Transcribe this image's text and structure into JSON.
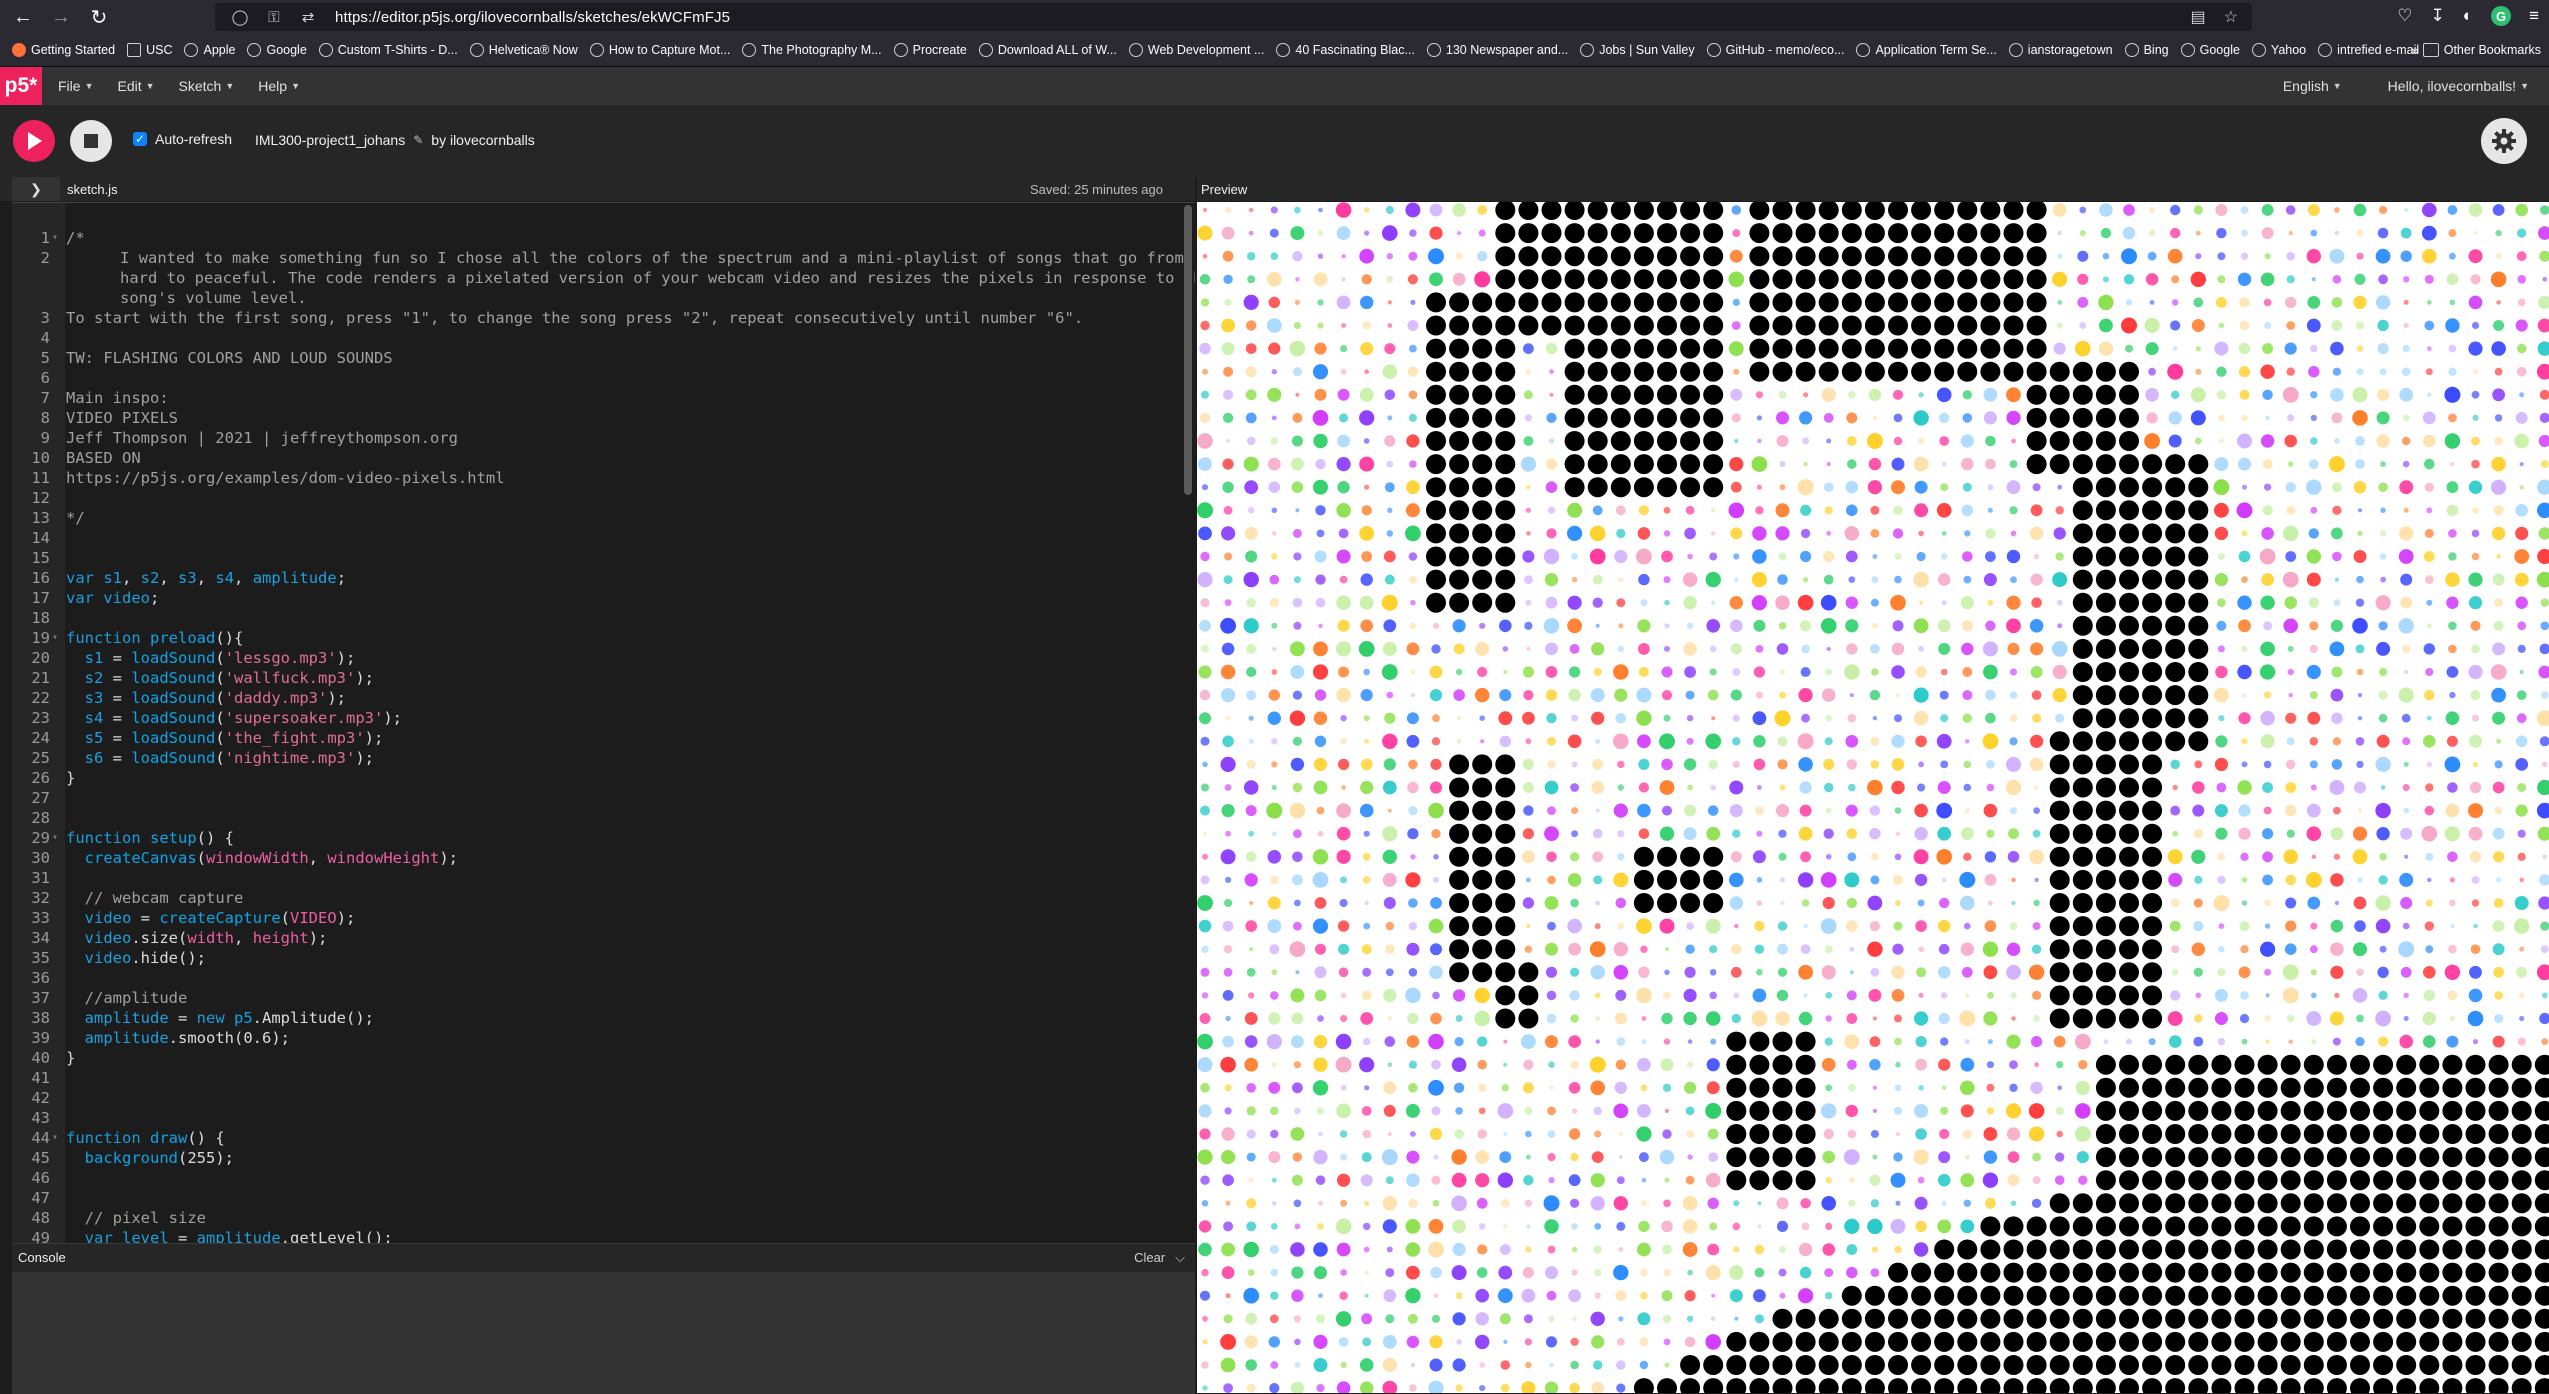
{
  "browser": {
    "url": "https://editor.p5js.org/ilovecornballs/sketches/ekWCFmFJ5",
    "bookmarks": [
      {
        "label": "Getting Started",
        "icon": "firefox-icon"
      },
      {
        "label": "USC",
        "icon": "folder-icon"
      },
      {
        "label": "Apple",
        "icon": "globe-icon"
      },
      {
        "label": "Google",
        "icon": "google-icon"
      },
      {
        "label": "Custom T-Shirts - D...",
        "icon": "globe-icon"
      },
      {
        "label": "Helvetica® Now",
        "icon": "globe-icon"
      },
      {
        "label": "How to Capture Mot...",
        "icon": "globe-icon"
      },
      {
        "label": "The Photography M...",
        "icon": "globe-icon"
      },
      {
        "label": "Procreate",
        "icon": "globe-icon"
      },
      {
        "label": "Download ALL of W...",
        "icon": "globe-icon"
      },
      {
        "label": "Web Development ...",
        "icon": "globe-icon"
      },
      {
        "label": "40 Fascinating Blac...",
        "icon": "globe-icon"
      },
      {
        "label": "130 Newspaper and...",
        "icon": "globe-icon"
      },
      {
        "label": "Jobs | Sun Valley",
        "icon": "globe-icon"
      },
      {
        "label": "GitHub - memo/eco...",
        "icon": "globe-icon"
      },
      {
        "label": "Application Term Se...",
        "icon": "globe-icon"
      },
      {
        "label": "ianstoragetown",
        "icon": "globe-icon"
      },
      {
        "label": "Bing",
        "icon": "globe-icon"
      },
      {
        "label": "Google",
        "icon": "google-icon"
      },
      {
        "label": "Yahoo",
        "icon": "globe-icon"
      },
      {
        "label": "intrefied e-mail",
        "icon": "globe-icon"
      }
    ],
    "other_bookmarks": "Other Bookmarks"
  },
  "editor": {
    "logo": "p5*",
    "menus": [
      "File",
      "Edit",
      "Sketch",
      "Help"
    ],
    "language": "English",
    "greeting": "Hello, ilovecornballs!",
    "auto_refresh_label": "Auto-refresh",
    "auto_refresh_checked": true,
    "project_name": "IML300-project1_johans",
    "by_line": "by ilovecornballs",
    "file_name": "sketch.js",
    "saved_status": "Saved: 25 minutes ago",
    "preview_label": "Preview",
    "console_label": "Console",
    "console_clear": "Clear"
  },
  "code": [
    {
      "n": "1",
      "fold": true,
      "parts": [
        [
          "comment",
          "/*"
        ]
      ]
    },
    {
      "n": "2",
      "wrap": true,
      "parts": [
        [
          "comment",
          "I wanted to make something fun so I chose all the colors of the spectrum and a mini-playlist of songs that go from hard to peaceful. The code renders a pixelated version of your webcam video and resizes the pixels in response to the song's volume level."
        ]
      ]
    },
    {
      "n": "3",
      "parts": [
        [
          "comment",
          "To start with the first song, press \"1\", to change the song press \"2\", repeat consecutively until number \"6\"."
        ]
      ]
    },
    {
      "n": "4",
      "parts": []
    },
    {
      "n": "5",
      "parts": [
        [
          "comment",
          "TW: FLASHING COLORS AND LOUD SOUNDS"
        ]
      ]
    },
    {
      "n": "6",
      "parts": []
    },
    {
      "n": "7",
      "parts": [
        [
          "comment",
          "Main inspo:"
        ]
      ]
    },
    {
      "n": "8",
      "parts": [
        [
          "comment",
          "VIDEO PIXELS"
        ]
      ]
    },
    {
      "n": "9",
      "parts": [
        [
          "comment",
          "Jeff Thompson | 2021 | jeffreythompson.org"
        ]
      ]
    },
    {
      "n": "10",
      "parts": [
        [
          "comment",
          "BASED ON"
        ]
      ]
    },
    {
      "n": "11",
      "parts": [
        [
          "comment",
          "https://p5js.org/examples/dom-video-pixels.html"
        ]
      ]
    },
    {
      "n": "12",
      "parts": []
    },
    {
      "n": "13",
      "parts": [
        [
          "comment",
          "*/"
        ]
      ]
    },
    {
      "n": "14",
      "parts": []
    },
    {
      "n": "15",
      "parts": []
    },
    {
      "n": "16",
      "parts": [
        [
          "kw",
          "var "
        ],
        [
          "var",
          "s1"
        ],
        [
          "plain",
          ", "
        ],
        [
          "var",
          "s2"
        ],
        [
          "plain",
          ", "
        ],
        [
          "var",
          "s3"
        ],
        [
          "plain",
          ", "
        ],
        [
          "var",
          "s4"
        ],
        [
          "plain",
          ", "
        ],
        [
          "var",
          "amplitude"
        ],
        [
          "plain",
          ";"
        ]
      ]
    },
    {
      "n": "17",
      "parts": [
        [
          "kw",
          "var "
        ],
        [
          "var",
          "video"
        ],
        [
          "plain",
          ";"
        ]
      ]
    },
    {
      "n": "18",
      "parts": []
    },
    {
      "n": "19",
      "fold": true,
      "parts": [
        [
          "kw",
          "function "
        ],
        [
          "fn",
          "preload"
        ],
        [
          "plain",
          "(){"
        ]
      ]
    },
    {
      "n": "20",
      "parts": [
        [
          "plain",
          "  "
        ],
        [
          "var",
          "s1"
        ],
        [
          "plain",
          " = "
        ],
        [
          "fn",
          "loadSound"
        ],
        [
          "plain",
          "("
        ],
        [
          "str",
          "'lessgo.mp3'"
        ],
        [
          "plain",
          ");"
        ]
      ]
    },
    {
      "n": "21",
      "parts": [
        [
          "plain",
          "  "
        ],
        [
          "var",
          "s2"
        ],
        [
          "plain",
          " = "
        ],
        [
          "fn",
          "loadSound"
        ],
        [
          "plain",
          "("
        ],
        [
          "str",
          "'wallfuck.mp3'"
        ],
        [
          "plain",
          ");"
        ]
      ]
    },
    {
      "n": "22",
      "parts": [
        [
          "plain",
          "  "
        ],
        [
          "var",
          "s3"
        ],
        [
          "plain",
          " = "
        ],
        [
          "fn",
          "loadSound"
        ],
        [
          "plain",
          "("
        ],
        [
          "str",
          "'daddy.mp3'"
        ],
        [
          "plain",
          ");"
        ]
      ]
    },
    {
      "n": "23",
      "parts": [
        [
          "plain",
          "  "
        ],
        [
          "var",
          "s4"
        ],
        [
          "plain",
          " = "
        ],
        [
          "fn",
          "loadSound"
        ],
        [
          "plain",
          "("
        ],
        [
          "str",
          "'supersoaker.mp3'"
        ],
        [
          "plain",
          ");"
        ]
      ]
    },
    {
      "n": "24",
      "parts": [
        [
          "plain",
          "  "
        ],
        [
          "var",
          "s5"
        ],
        [
          "plain",
          " = "
        ],
        [
          "fn",
          "loadSound"
        ],
        [
          "plain",
          "("
        ],
        [
          "str",
          "'the_fight.mp3'"
        ],
        [
          "plain",
          ");"
        ]
      ]
    },
    {
      "n": "25",
      "parts": [
        [
          "plain",
          "  "
        ],
        [
          "var",
          "s6"
        ],
        [
          "plain",
          " = "
        ],
        [
          "fn",
          "loadSound"
        ],
        [
          "plain",
          "("
        ],
        [
          "str",
          "'nightime.mp3'"
        ],
        [
          "plain",
          ");"
        ]
      ]
    },
    {
      "n": "26",
      "parts": [
        [
          "plain",
          "}"
        ]
      ]
    },
    {
      "n": "27",
      "parts": []
    },
    {
      "n": "28",
      "parts": []
    },
    {
      "n": "29",
      "fold": true,
      "parts": [
        [
          "kw",
          "function "
        ],
        [
          "fn",
          "setup"
        ],
        [
          "plain",
          "() {"
        ]
      ]
    },
    {
      "n": "30",
      "parts": [
        [
          "plain",
          "  "
        ],
        [
          "fn",
          "createCanvas"
        ],
        [
          "plain",
          "("
        ],
        [
          "pink",
          "windowWidth"
        ],
        [
          "plain",
          ", "
        ],
        [
          "pink",
          "windowHeight"
        ],
        [
          "plain",
          ");"
        ]
      ]
    },
    {
      "n": "31",
      "parts": []
    },
    {
      "n": "32",
      "parts": [
        [
          "plain",
          "  "
        ],
        [
          "comment",
          "// webcam capture"
        ]
      ]
    },
    {
      "n": "33",
      "parts": [
        [
          "plain",
          "  "
        ],
        [
          "var",
          "video"
        ],
        [
          "plain",
          " = "
        ],
        [
          "fn",
          "createCapture"
        ],
        [
          "plain",
          "("
        ],
        [
          "pink",
          "VIDEO"
        ],
        [
          "plain",
          ");"
        ]
      ]
    },
    {
      "n": "34",
      "parts": [
        [
          "plain",
          "  "
        ],
        [
          "var",
          "video"
        ],
        [
          "plain",
          ".size("
        ],
        [
          "pink",
          "width"
        ],
        [
          "plain",
          ", "
        ],
        [
          "pink",
          "height"
        ],
        [
          "plain",
          ");"
        ]
      ]
    },
    {
      "n": "35",
      "parts": [
        [
          "plain",
          "  "
        ],
        [
          "var",
          "video"
        ],
        [
          "plain",
          ".hide();"
        ]
      ]
    },
    {
      "n": "36",
      "parts": []
    },
    {
      "n": "37",
      "parts": [
        [
          "plain",
          "  "
        ],
        [
          "comment",
          "//amplitude"
        ]
      ]
    },
    {
      "n": "38",
      "parts": [
        [
          "plain",
          "  "
        ],
        [
          "var",
          "amplitude"
        ],
        [
          "plain",
          " = "
        ],
        [
          "kw",
          "new "
        ],
        [
          "fn",
          "p5"
        ],
        [
          "plain",
          ".Amplitude();"
        ]
      ]
    },
    {
      "n": "39",
      "parts": [
        [
          "plain",
          "  "
        ],
        [
          "var",
          "amplitude"
        ],
        [
          "plain",
          ".smooth(0.6);"
        ]
      ]
    },
    {
      "n": "40",
      "parts": [
        [
          "plain",
          "}"
        ]
      ]
    },
    {
      "n": "41",
      "parts": []
    },
    {
      "n": "42",
      "parts": []
    },
    {
      "n": "43",
      "parts": []
    },
    {
      "n": "44",
      "fold": true,
      "parts": [
        [
          "kw",
          "function "
        ],
        [
          "fn",
          "draw"
        ],
        [
          "plain",
          "() {"
        ]
      ]
    },
    {
      "n": "45",
      "parts": [
        [
          "plain",
          "  "
        ],
        [
          "fn",
          "background"
        ],
        [
          "plain",
          "(255);"
        ]
      ]
    },
    {
      "n": "46",
      "parts": []
    },
    {
      "n": "47",
      "parts": []
    },
    {
      "n": "48",
      "parts": [
        [
          "plain",
          "  "
        ],
        [
          "comment",
          "// pixel size"
        ]
      ]
    },
    {
      "n": "49",
      "parts": [
        [
          "plain",
          "  "
        ],
        [
          "kw",
          "var "
        ],
        [
          "var",
          "level"
        ],
        [
          "plain",
          " = "
        ],
        [
          "var",
          "amplitude"
        ],
        [
          "plain",
          ".getLevel();"
        ]
      ]
    }
  ]
}
